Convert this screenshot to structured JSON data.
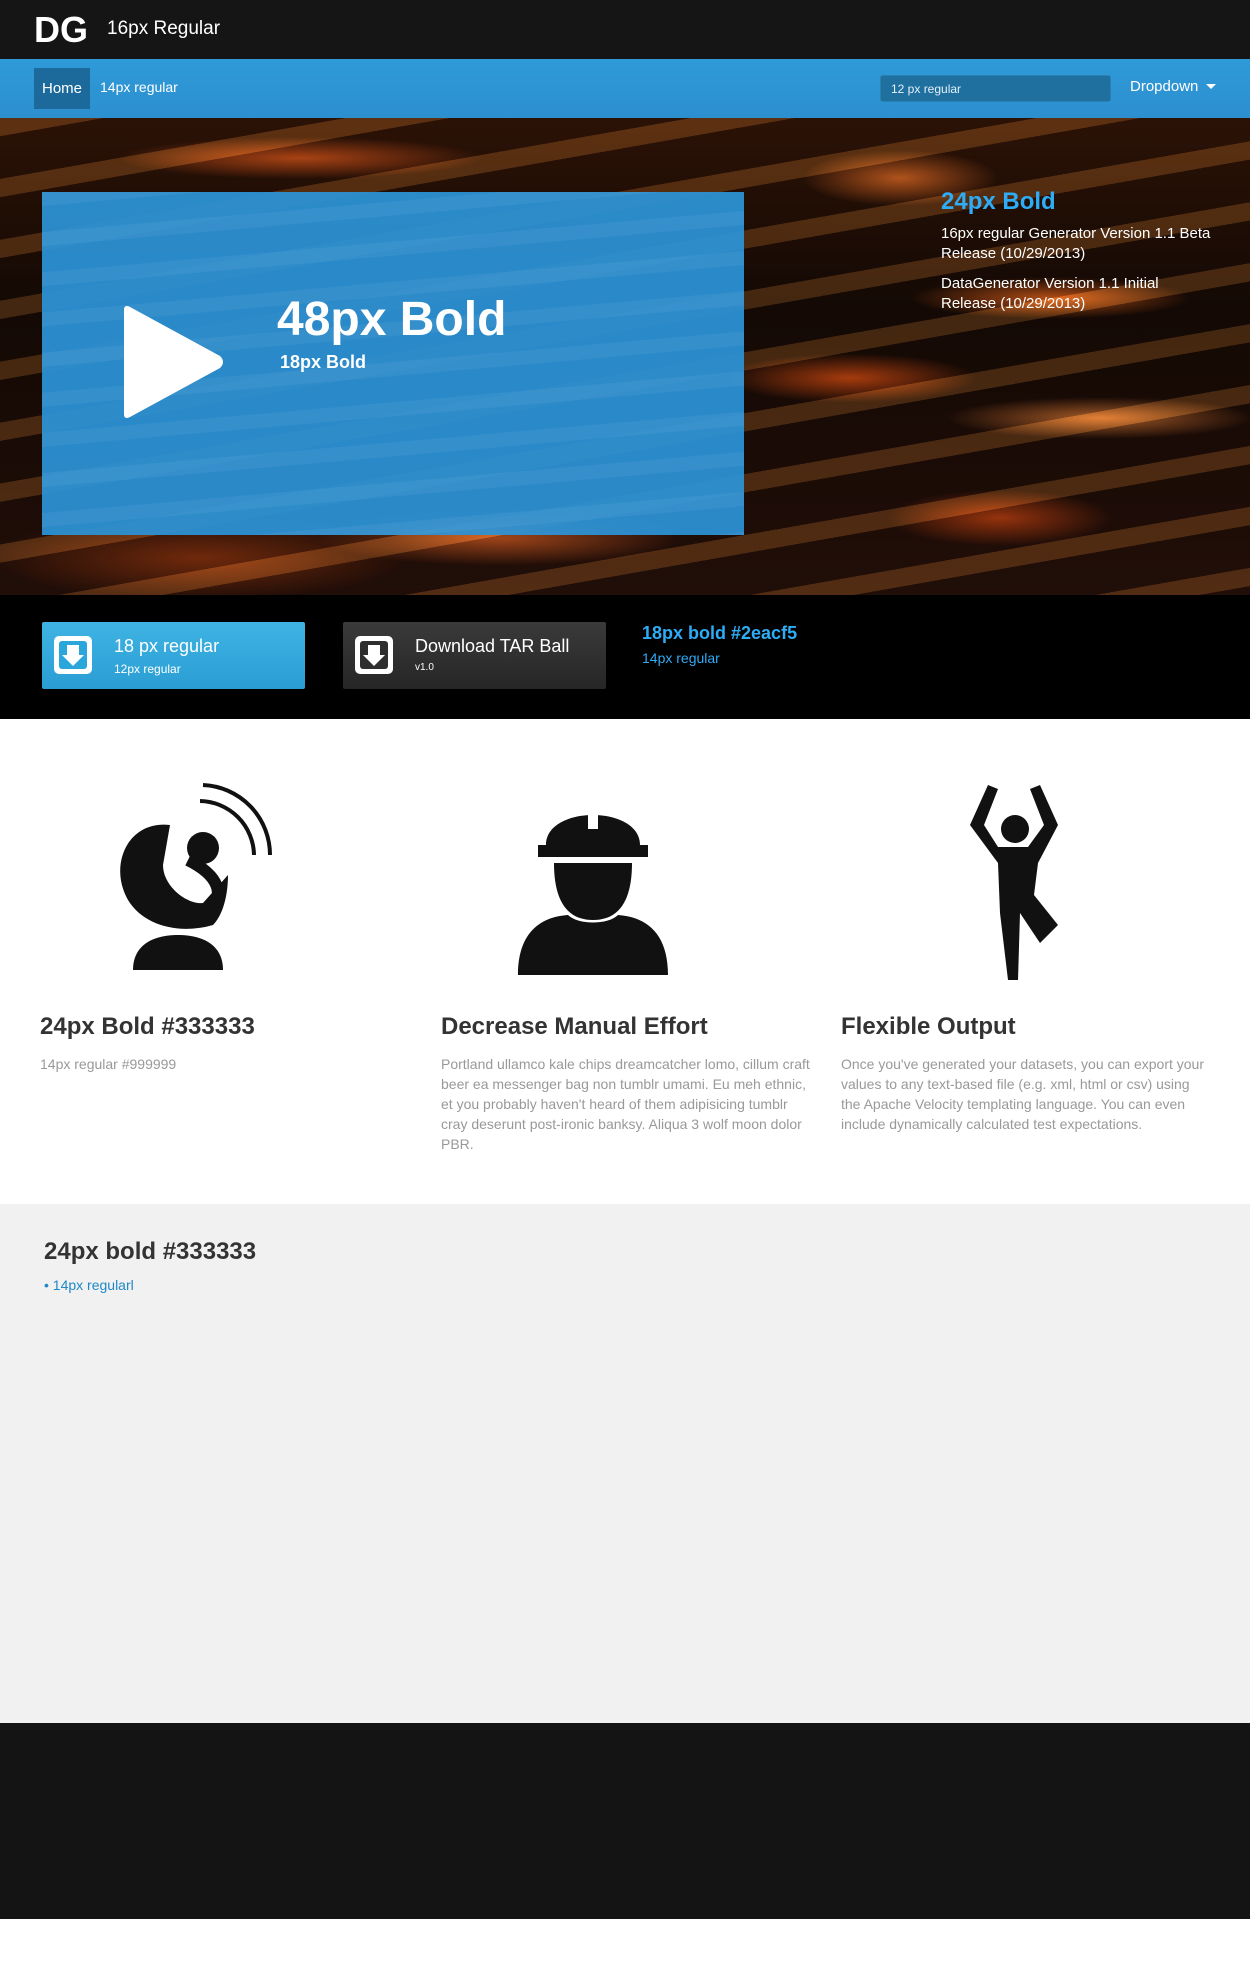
{
  "topbar": {
    "logo_text": "DG",
    "brand": "16px Regular"
  },
  "nav": {
    "home": "Home",
    "link": "14px regular",
    "search_placeholder": "12 px regular",
    "dropdown": "Dropdown"
  },
  "hero": {
    "video_title": "48px Bold",
    "video_sub": "18px Bold",
    "news_title": "24px Bold",
    "news_items": [
      "16px regular Generator Version 1.1 Beta Release (10/29/2013)",
      "DataGenerator Version 1.1 Initial Release (10/29/2013)"
    ]
  },
  "downloads": {
    "primary_title": "18 px regular",
    "primary_sub": "12px regular",
    "secondary_title": "Download TAR Ball",
    "secondary_sub": "v1.0",
    "info_title": "18px bold #2eacf5",
    "info_sub": "14px regular"
  },
  "features": [
    {
      "icon": "satellite-dish-icon",
      "title": "24px Bold #333333",
      "text": "14px regular #999999"
    },
    {
      "icon": "construction-worker-icon",
      "title": "Decrease Manual Effort",
      "text": "Portland ullamco kale chips dreamcatcher lomo, cillum craft beer ea messenger bag non tumblr umami. Eu meh ethnic, et you probably haven't heard of them adipisicing tumblr cray deserunt post-ironic banksy. Aliqua 3 wolf moon dolor PBR."
    },
    {
      "icon": "yoga-pose-icon",
      "title": "Flexible Output",
      "text": "Once you've generated your datasets, you can export your values to any text-based file (e.g. xml, html or csv) using the Apache Velocity templating language. You can even include dynamically calculated test expectations."
    }
  ],
  "gray_section": {
    "title": "24px bold #333333",
    "items": [
      "14px regularl"
    ]
  },
  "colors": {
    "accent": "#2eacf5",
    "nav_blue": "#2c93d4",
    "heading": "#333333",
    "muted": "#999999",
    "dark": "#151515"
  }
}
